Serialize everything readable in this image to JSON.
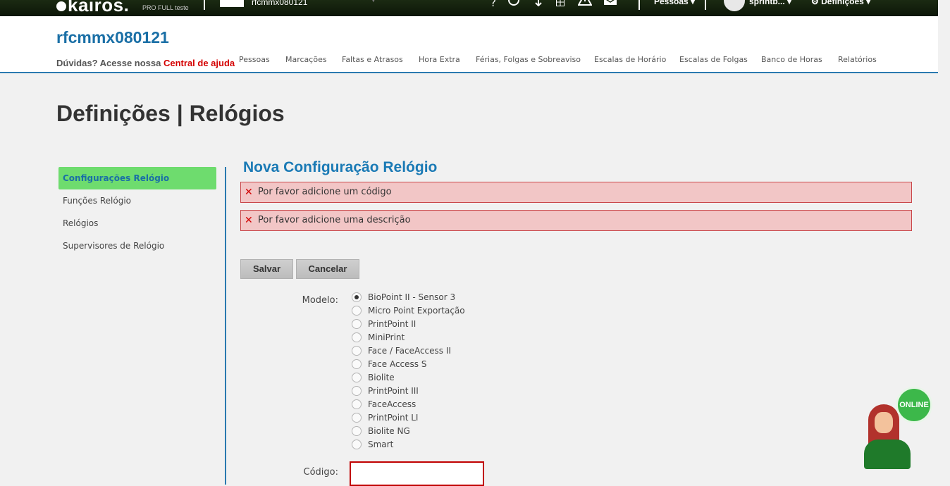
{
  "topbar": {
    "logo": "kairos.",
    "logo_sub": "PRO FULL teste",
    "company": "rfcmmx080121",
    "icons": [
      "help-icon",
      "chat-icon",
      "cloud-download-icon",
      "calculator-icon",
      "warning-icon",
      "mail-icon"
    ],
    "help_glyph": "?",
    "pessoas_menu": "Pessoas",
    "user_menu": "sprintb...",
    "settings_menu": "Definições"
  },
  "header": {
    "company_title": "rfcmmx080121",
    "help_prefix": "Dúvidas? Acesse nossa",
    "help_link": "Central de ajuda",
    "nav": [
      "Pessoas",
      "Marcações",
      "Faltas e Atrasos",
      "Hora Extra",
      "Férias, Folgas e Sobreaviso",
      "Escalas de Horário",
      "Escalas de Folgas",
      "Banco de Horas",
      "Relatórios"
    ]
  },
  "page_title": "Definições | Relógios",
  "sidebar": {
    "items": [
      {
        "label": "Configurações Relógio",
        "active": true
      },
      {
        "label": "Funções Relógio",
        "active": false
      },
      {
        "label": "Relógios",
        "active": false
      },
      {
        "label": "Supervisores de Relógio",
        "active": false
      }
    ]
  },
  "form": {
    "title": "Nova Configuração Relógio",
    "errors": [
      "Por favor adicione um código",
      "Por favor adicione uma descrição"
    ],
    "save_label": "Salvar",
    "cancel_label": "Cancelar",
    "modelo_label": "Modelo:",
    "modelo_options": [
      {
        "label": "BioPoint II - Sensor 3",
        "selected": true
      },
      {
        "label": "Micro Point Exportação",
        "selected": false
      },
      {
        "label": "PrintPoint II",
        "selected": false
      },
      {
        "label": "MiniPrint",
        "selected": false
      },
      {
        "label": "Face / FaceAccess II",
        "selected": false
      },
      {
        "label": "Face Access S",
        "selected": false
      },
      {
        "label": "Biolite",
        "selected": false
      },
      {
        "label": "PrintPoint III",
        "selected": false
      },
      {
        "label": "FaceAccess",
        "selected": false
      },
      {
        "label": "PrintPoint LI",
        "selected": false
      },
      {
        "label": "Biolite NG",
        "selected": false
      },
      {
        "label": "Smart",
        "selected": false
      }
    ],
    "codigo_label": "Código:",
    "codigo_value": ""
  },
  "chat": {
    "online_label": "ONLINE"
  },
  "colors": {
    "accent_blue": "#1a6fa6",
    "active_green": "#6edc6e",
    "error_bg": "#f2c6c6",
    "error_red": "#c00000"
  }
}
